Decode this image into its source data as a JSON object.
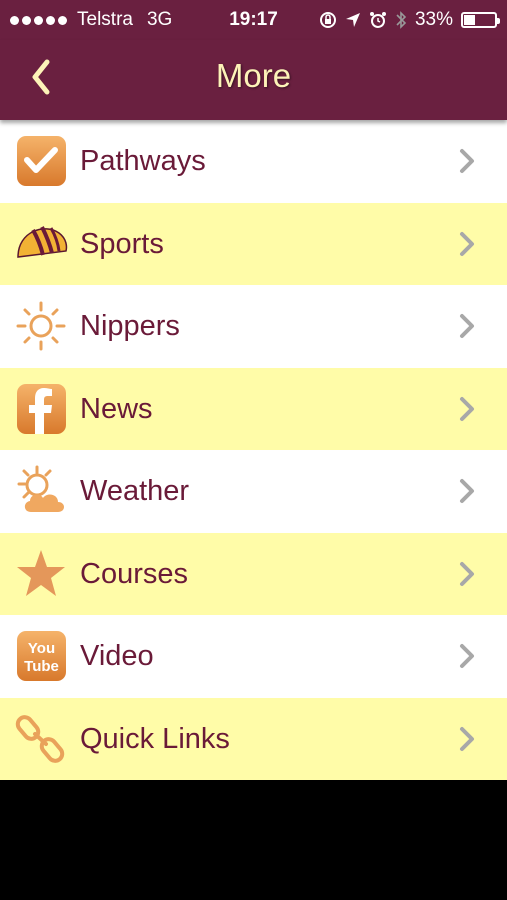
{
  "status_bar": {
    "carrier": "Telstra",
    "network": "3G",
    "time": "19:17",
    "battery": "33%",
    "battery_level": 0.33
  },
  "nav": {
    "title": "More",
    "back_icon": "chevron-left-icon"
  },
  "menu_items": [
    {
      "label": "Pathways",
      "icon": "checkmark-icon"
    },
    {
      "label": "Sports",
      "icon": "football-icon"
    },
    {
      "label": "Nippers",
      "icon": "sun-icon"
    },
    {
      "label": "News",
      "icon": "facebook-icon"
    },
    {
      "label": "Weather",
      "icon": "weather-icon"
    },
    {
      "label": "Courses",
      "icon": "star-icon"
    },
    {
      "label": "Video",
      "icon": "youtube-icon"
    },
    {
      "label": "Quick Links",
      "icon": "link-icon"
    }
  ],
  "youtube_icon_text": {
    "line1": "You",
    "line2": "Tube"
  },
  "colors": {
    "brand": "#6a2040",
    "row_alt": "#fffca8",
    "label": "#6a1a38",
    "icon_orange": "#e58f3a",
    "title": "#fdf3b8"
  }
}
